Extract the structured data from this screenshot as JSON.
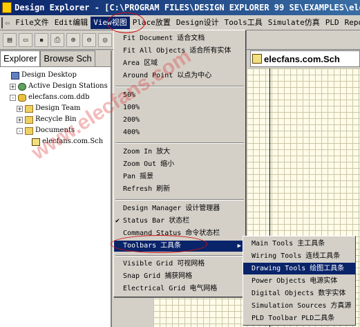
{
  "window": {
    "title": "Design Explorer - [C:\\PROGRAM FILES\\DESIGN EXPLORER 99 SE\\EXAMPLES\\elecfans.ddb]"
  },
  "menubar": [
    {
      "label": "File文件",
      "open": false
    },
    {
      "label": "Edit编辑",
      "open": false
    },
    {
      "label": "View视图",
      "open": true
    },
    {
      "label": "Place放置",
      "open": false
    },
    {
      "label": "Design设计",
      "open": false
    },
    {
      "label": "Tools工具",
      "open": false
    },
    {
      "label": "Simulate仿真",
      "open": false
    },
    {
      "label": "PLD",
      "open": false
    },
    {
      "label": "Repo",
      "open": false
    }
  ],
  "panel": {
    "tabs": [
      "Explorer",
      "Browse Sch"
    ],
    "active_tab": "Explorer",
    "tree": [
      {
        "label": "Design Desktop",
        "icon": "desktop-icon",
        "expander": "none",
        "indent": 0
      },
      {
        "label": "Active Design Stations",
        "icon": "globe-icon",
        "expander": "+",
        "indent": 1
      },
      {
        "label": "elecfans.com.ddb",
        "icon": "database-icon",
        "expander": "-",
        "indent": 1
      },
      {
        "label": "Design Team",
        "icon": "folder-icon",
        "expander": "+",
        "indent": 2
      },
      {
        "label": "Recycle Bin",
        "icon": "folder-icon",
        "expander": "+",
        "indent": 2
      },
      {
        "label": "Documents",
        "icon": "folder-icon",
        "expander": "-",
        "indent": 2
      },
      {
        "label": "elecfans.com.Sch",
        "icon": "schematic-icon",
        "expander": "none",
        "indent": 3
      }
    ]
  },
  "document_tab": {
    "label": "elecfans.com.Sch"
  },
  "view_menu": {
    "items": [
      {
        "label": "Fit Document 适合文档",
        "checked": false,
        "submenu": false,
        "highlighted": false
      },
      {
        "label": "Fit All Objects 适合所有实体",
        "checked": false,
        "submenu": false,
        "highlighted": false
      },
      {
        "label": "Area 区域",
        "checked": false,
        "submenu": false,
        "highlighted": false
      },
      {
        "label": "Around Point 以点为中心",
        "checked": false,
        "submenu": false,
        "highlighted": false
      },
      {
        "separator": true
      },
      {
        "label": "50%",
        "checked": false,
        "submenu": false,
        "highlighted": false
      },
      {
        "label": "100%",
        "checked": false,
        "submenu": false,
        "highlighted": false
      },
      {
        "label": "200%",
        "checked": false,
        "submenu": false,
        "highlighted": false
      },
      {
        "label": "400%",
        "checked": false,
        "submenu": false,
        "highlighted": false
      },
      {
        "separator": true
      },
      {
        "label": "Zoom In 放大",
        "checked": false,
        "submenu": false,
        "highlighted": false
      },
      {
        "label": "Zoom Out 缩小",
        "checked": false,
        "submenu": false,
        "highlighted": false
      },
      {
        "label": "Pan 摇景",
        "checked": false,
        "submenu": false,
        "highlighted": false
      },
      {
        "label": "Refresh 刷新",
        "checked": false,
        "submenu": false,
        "highlighted": false
      },
      {
        "separator": true
      },
      {
        "label": "Design Manager 设计管理器",
        "checked": false,
        "submenu": false,
        "highlighted": false
      },
      {
        "label": "Status Bar 状态栏",
        "checked": true,
        "submenu": false,
        "highlighted": false
      },
      {
        "label": "Command Status 命令状态栏",
        "checked": false,
        "submenu": false,
        "highlighted": false
      },
      {
        "label": "Toolbars 工具条",
        "checked": false,
        "submenu": true,
        "highlighted": true
      },
      {
        "separator": true
      },
      {
        "label": "Visible Grid 可视网格",
        "checked": false,
        "submenu": false,
        "highlighted": false
      },
      {
        "label": "Snap Grid 捕获网格",
        "checked": false,
        "submenu": false,
        "highlighted": false
      },
      {
        "label": "Electrical Grid 电气网格",
        "checked": false,
        "submenu": false,
        "highlighted": false
      }
    ]
  },
  "toolbars_submenu": {
    "items": [
      {
        "label": "Main Tools 主工具条",
        "highlighted": false
      },
      {
        "label": "Wiring Tools 连线工具条",
        "highlighted": false
      },
      {
        "label": "Drawing Tools 绘图工具条",
        "highlighted": true
      },
      {
        "label": "Power Objects 电源实体",
        "highlighted": false
      },
      {
        "label": "Digital Objects 数字实体",
        "highlighted": false
      },
      {
        "label": "Simulation Sources 方真源",
        "highlighted": false
      },
      {
        "label": "PLD Toolbar PLD二具条",
        "highlighted": false
      }
    ]
  },
  "watermark": {
    "text": "www.elecfans.com"
  },
  "colors": {
    "highlight": "#0a246a",
    "annotation": "#d01010",
    "grid_bg": "#fffbe8"
  }
}
